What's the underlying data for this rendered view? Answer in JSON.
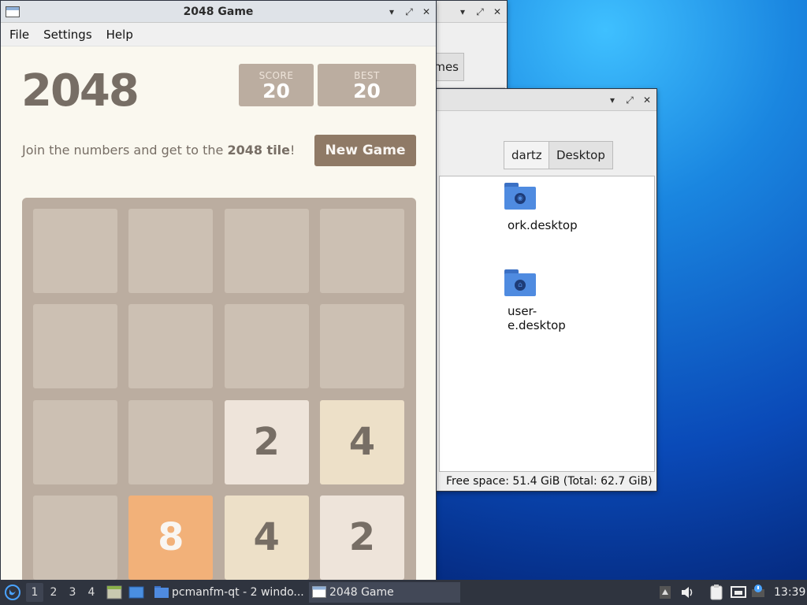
{
  "back_window_1": {
    "tab_label": "mes"
  },
  "back_window_2": {
    "tabs": [
      "dartz",
      "Desktop"
    ],
    "files": [
      {
        "name_line1": "ork.desktop",
        "name_line2": "",
        "icon": "globe-folder-icon"
      },
      {
        "name_line1": "user-",
        "name_line2": "e.desktop",
        "icon": "home-folder-icon"
      }
    ],
    "status": "Free space: 51.4 GiB (Total: 62.7 GiB)"
  },
  "game_window": {
    "title": "2048 Game",
    "menu": [
      "File",
      "Settings",
      "Help"
    ],
    "heading": "2048",
    "score_label": "SCORE",
    "score_value": "20",
    "best_label": "BEST",
    "best_value": "20",
    "intro_text": "Join the numbers and get to the ",
    "intro_bold": "2048 tile",
    "intro_end": "!",
    "new_game_label": "New Game",
    "board": [
      [
        "",
        "",
        "",
        ""
      ],
      [
        "",
        "",
        "",
        ""
      ],
      [
        "",
        "",
        "2",
        "4"
      ],
      [
        "",
        "8",
        "4",
        "2"
      ]
    ],
    "tile_colors": {
      "2": {
        "bg": "#eee4da",
        "fg": "#776e65"
      },
      "4": {
        "bg": "#ede0c8",
        "fg": "#776e65"
      },
      "8": {
        "bg": "#f2b179",
        "fg": "#f9f6f2"
      }
    }
  },
  "taskbar": {
    "workspaces": [
      "1",
      "2",
      "3",
      "4"
    ],
    "active_workspace": "1",
    "tasks": [
      {
        "label": "pcmanfm-qt - 2 windo...",
        "icon": "folder-icon"
      },
      {
        "label": "2048 Game",
        "icon": "window-icon"
      }
    ],
    "clock": "13:39"
  }
}
